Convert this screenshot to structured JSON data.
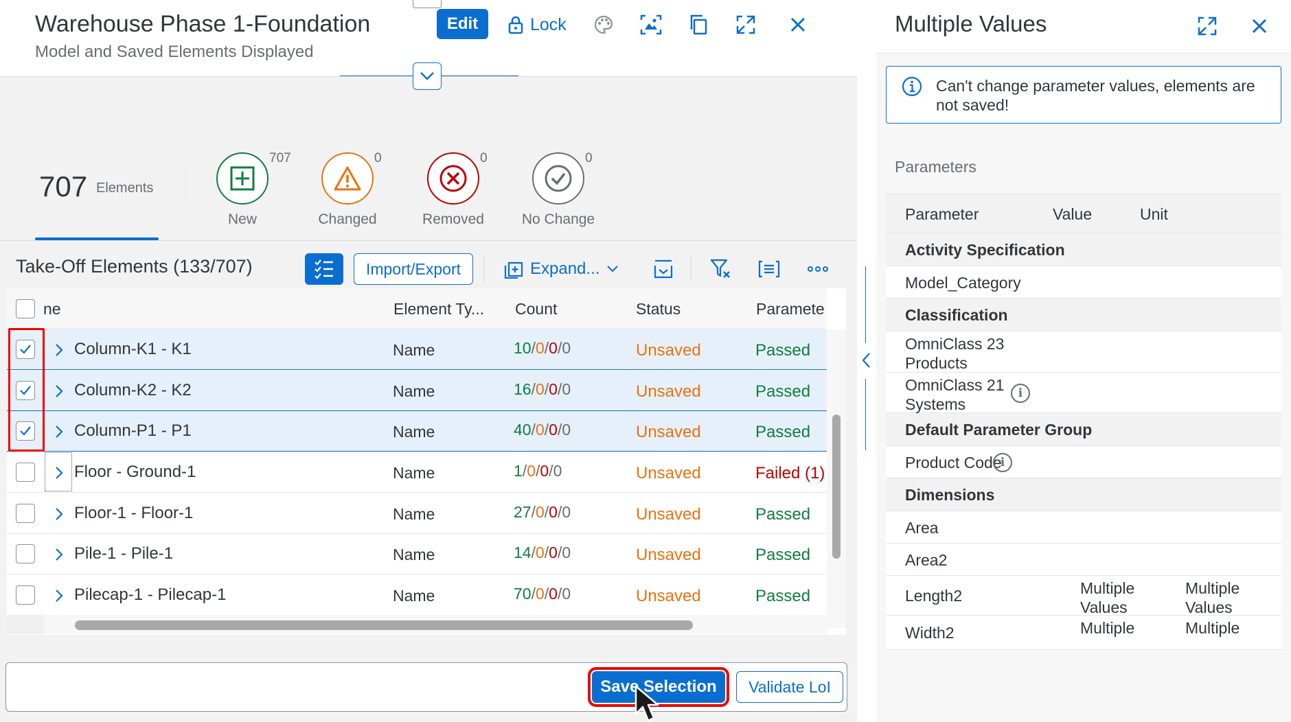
{
  "header": {
    "title": "Warehouse Phase 1-Foundation",
    "subtitle": "Model and Saved Elements Displayed",
    "edit_label": "Edit",
    "lock_label": "Lock",
    "icons": [
      "palette-icon",
      "image-recognition-icon",
      "copy-icon",
      "fullscreen-icon",
      "close-icon"
    ]
  },
  "kpi": {
    "count": "707",
    "label": "Elements",
    "tiles": [
      {
        "label": "New",
        "count": "707",
        "color": "#107e3e",
        "icon": "add-square-icon"
      },
      {
        "label": "Changed",
        "count": "0",
        "color": "#e9730c",
        "icon": "warning-icon"
      },
      {
        "label": "Removed",
        "count": "0",
        "color": "#bb0000",
        "icon": "error-icon"
      },
      {
        "label": "No Change",
        "count": "0",
        "color": "#6a6d70",
        "icon": "checkmark-icon"
      }
    ]
  },
  "toolbar": {
    "title": "Take-Off Elements (133/707)",
    "import_export_label": "Import/Export",
    "expand_label": "Expand..."
  },
  "table": {
    "columns": [
      "ne",
      "Element Ty...",
      "Count",
      "Status",
      "Paramete"
    ],
    "rows": [
      {
        "name": "Column-K1 - K1",
        "type": "Name",
        "count": [
          "10",
          "0",
          "0",
          "0"
        ],
        "status": "Unsaved",
        "param": "Passed",
        "selected": true
      },
      {
        "name": "Column-K2 - K2",
        "type": "Name",
        "count": [
          "16",
          "0",
          "0",
          "0"
        ],
        "status": "Unsaved",
        "param": "Passed",
        "selected": true
      },
      {
        "name": "Column-P1 - P1",
        "type": "Name",
        "count": [
          "40",
          "0",
          "0",
          "0"
        ],
        "status": "Unsaved",
        "param": "Passed",
        "selected": true
      },
      {
        "name": "Floor - Ground-1",
        "type": "Name",
        "count": [
          "1",
          "0",
          "0",
          "0"
        ],
        "status": "Unsaved",
        "param": "Failed (1)",
        "selected": false
      },
      {
        "name": "Floor-1 - Floor-1",
        "type": "Name",
        "count": [
          "27",
          "0",
          "0",
          "0"
        ],
        "status": "Unsaved",
        "param": "Passed",
        "selected": false
      },
      {
        "name": "Pile-1 - Pile-1",
        "type": "Name",
        "count": [
          "14",
          "0",
          "0",
          "0"
        ],
        "status": "Unsaved",
        "param": "Passed",
        "selected": false
      },
      {
        "name": "Pilecap-1 - Pilecap-1",
        "type": "Name",
        "count": [
          "70",
          "0",
          "0",
          "0"
        ],
        "status": "Unsaved",
        "param": "Passed",
        "selected": false
      }
    ]
  },
  "footer": {
    "save_label": "Save Selection",
    "validate_label": "Validate LoI"
  },
  "side_panel": {
    "title": "Multiple Values",
    "info_message": "Can't change parameter values, elements are not saved!",
    "section_label": "Parameters",
    "columns": [
      "Parameter",
      "Value",
      "Unit"
    ],
    "rows": [
      {
        "name": "Activity Specification",
        "group": true
      },
      {
        "name": "Model_Category"
      },
      {
        "name": "Classification",
        "group": true
      },
      {
        "name": "OmniClass 23 Products"
      },
      {
        "name": "OmniClass 21 Systems",
        "info": true
      },
      {
        "name": "Default Parameter Group",
        "group": true
      },
      {
        "name": "Product Code",
        "info": true
      },
      {
        "name": "Dimensions",
        "group": true
      },
      {
        "name": "Area"
      },
      {
        "name": "Area2"
      },
      {
        "name": "Length2",
        "value": "Multiple Values",
        "unit": "Multiple Values"
      },
      {
        "name": "Width2",
        "value": "Multiple",
        "unit": "Multiple"
      }
    ]
  }
}
